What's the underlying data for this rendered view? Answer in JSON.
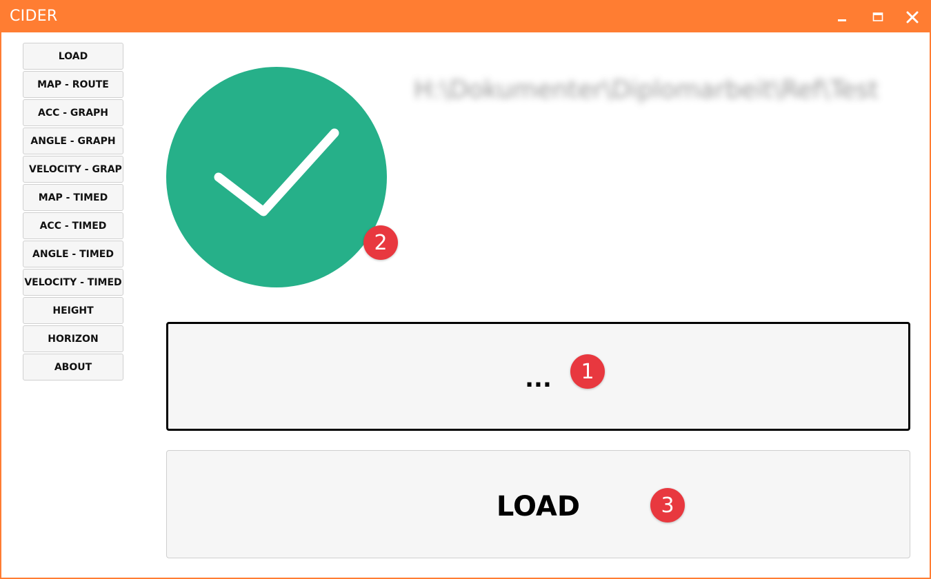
{
  "window": {
    "title": "CIDER",
    "title_bar_color": "#ff7d32",
    "controls": [
      "minimize-icon",
      "maximize-icon",
      "close-icon"
    ]
  },
  "sidebar": {
    "items": [
      {
        "label": "LOAD"
      },
      {
        "label": "MAP - ROUTE"
      },
      {
        "label": "ACC - GRAPH"
      },
      {
        "label": "ANGLE - GRAPH"
      },
      {
        "label": "VELOCITY - GRAPH"
      },
      {
        "label": "MAP - TIMED"
      },
      {
        "label": "ACC - TIMED"
      },
      {
        "label": "ANGLE - TIMED"
      },
      {
        "label": "VELOCITY - TIMED"
      },
      {
        "label": "HEIGHT"
      },
      {
        "label": "HORIZON"
      },
      {
        "label": "ABOUT"
      }
    ]
  },
  "main": {
    "status": {
      "icon": "check-icon",
      "color": "#26b089"
    },
    "file_path_blurred": "H:\\Dokumenter\\Diplomarbeit\\Ref\\Test",
    "browse_button_label": "...",
    "load_button_label": "LOAD",
    "badges": {
      "one": "1",
      "two": "2",
      "three": "3"
    },
    "badge_color": "#e8383f"
  }
}
